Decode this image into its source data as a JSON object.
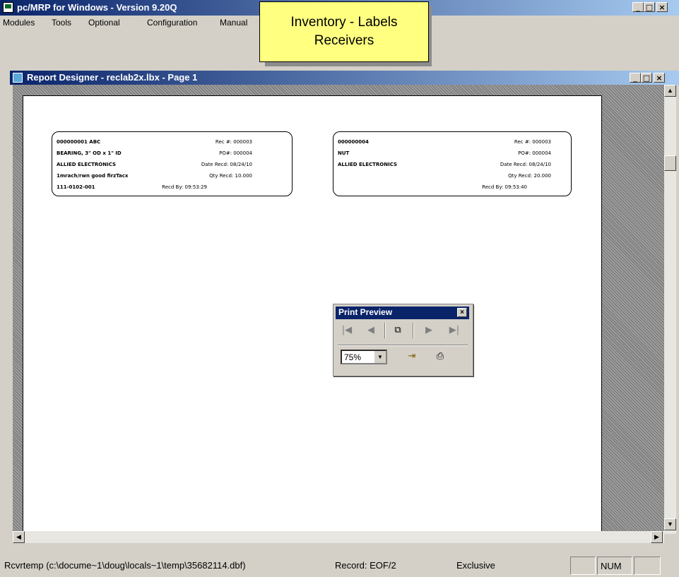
{
  "app": {
    "title": "pc/MRP for Windows - Version 9.20Q",
    "window_buttons": [
      "_",
      "□",
      "×"
    ]
  },
  "menu": [
    "Modules",
    "Tools",
    "Optional",
    "Configuration",
    "Manual"
  ],
  "callout": {
    "line1": "Inventory - Labels",
    "line2": "Receivers"
  },
  "child": {
    "title": "Report Designer - reclab2x.lbx - Page 1",
    "window_buttons": [
      "_",
      "□",
      "×"
    ]
  },
  "labels": [
    {
      "left": [
        "000000001 ABC",
        "BEARING, 3\" OD x 1\" ID",
        "ALLIED ELECTRONICS",
        "1mrach/rwn good firzTacx",
        "111-0102-001"
      ],
      "right": [
        "Rec #: 000003",
        "PO#: 000004",
        "Date Recd: 08/24/10",
        "Qty Recd: 10.000",
        "Recd By: 09:53:29"
      ]
    },
    {
      "left": [
        "000000004",
        "NUT",
        "ALLIED ELECTRONICS",
        "",
        ""
      ],
      "right": [
        "Rec #: 000003",
        "PO#: 000004",
        "Date Recd: 08/24/10",
        "Qty Recd: 20.000",
        "Recd By: 09:53:40"
      ]
    }
  ],
  "print_preview": {
    "title": "Print Preview",
    "close": "×",
    "zoom": "75%",
    "icons": [
      "first-page-icon",
      "prev-page-icon",
      "copy-pages-icon",
      "next-page-icon",
      "last-page-icon",
      "exit-icon",
      "printer-icon"
    ]
  },
  "status": {
    "table": "Rcvrtemp (c:\\docume~1\\doug\\locals~1\\temp\\35682114.dbf)",
    "record": "Record: EOF/2",
    "mode": "Exclusive",
    "num": "NUM"
  },
  "colors": {
    "titlebar": "#0a246a",
    "callout": "#ffff80",
    "face": "#d4d0c8"
  }
}
